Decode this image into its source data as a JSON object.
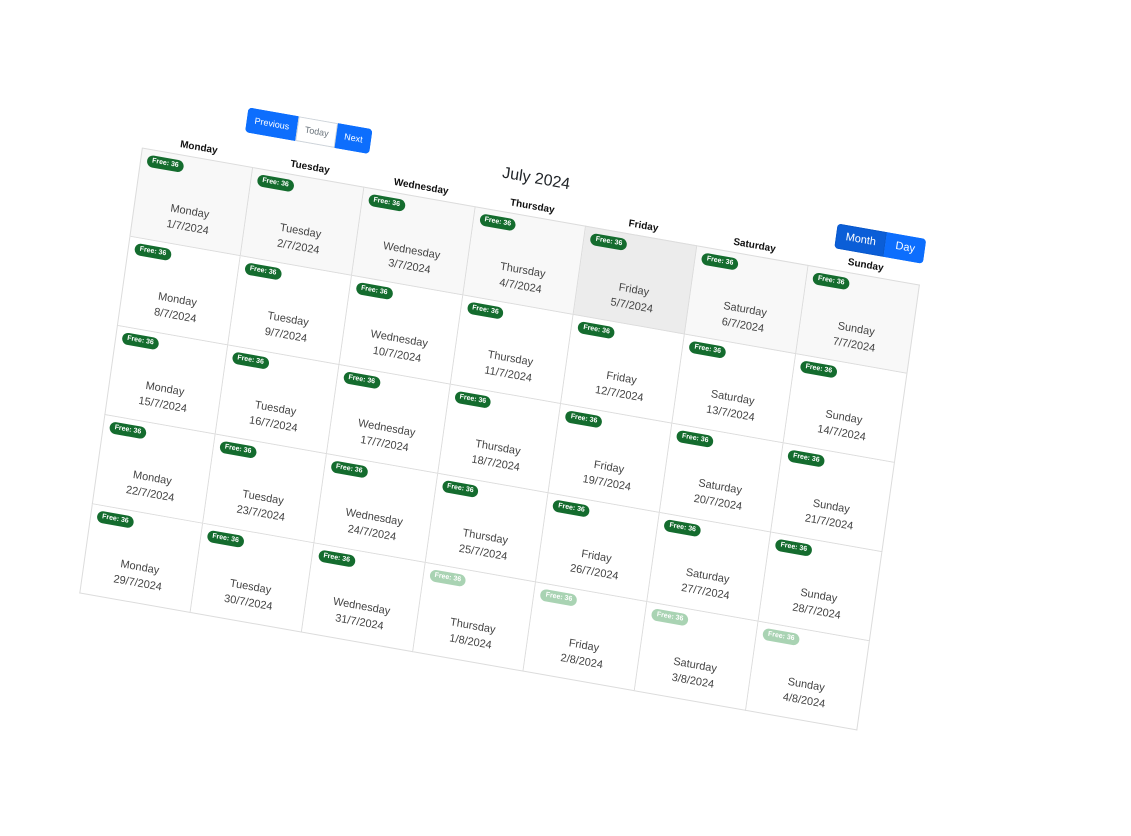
{
  "toolbar": {
    "previous_label": "Previous",
    "today_label": "Today",
    "next_label": "Next",
    "title": "July 2024",
    "month_label": "Month",
    "day_label": "Day"
  },
  "weekdays": [
    "Monday",
    "Tuesday",
    "Wednesday",
    "Thursday",
    "Friday",
    "Saturday",
    "Sunday"
  ],
  "weeks": [
    [
      {
        "badge": "Free: 36",
        "day": "Monday",
        "date": "1/7/2024",
        "state": "shade"
      },
      {
        "badge": "Free: 36",
        "day": "Tuesday",
        "date": "2/7/2024",
        "state": "shade"
      },
      {
        "badge": "Free: 36",
        "day": "Wednesday",
        "date": "3/7/2024",
        "state": "shade"
      },
      {
        "badge": "Free: 36",
        "day": "Thursday",
        "date": "4/7/2024",
        "state": "shade"
      },
      {
        "badge": "Free: 36",
        "day": "Friday",
        "date": "5/7/2024",
        "state": "today"
      },
      {
        "badge": "Free: 36",
        "day": "Saturday",
        "date": "6/7/2024",
        "state": "shade"
      },
      {
        "badge": "Free: 36",
        "day": "Sunday",
        "date": "7/7/2024",
        "state": "shade"
      }
    ],
    [
      {
        "badge": "Free: 36",
        "day": "Monday",
        "date": "8/7/2024",
        "state": "normal"
      },
      {
        "badge": "Free: 36",
        "day": "Tuesday",
        "date": "9/7/2024",
        "state": "normal"
      },
      {
        "badge": "Free: 36",
        "day": "Wednesday",
        "date": "10/7/2024",
        "state": "normal"
      },
      {
        "badge": "Free: 36",
        "day": "Thursday",
        "date": "11/7/2024",
        "state": "normal"
      },
      {
        "badge": "Free: 36",
        "day": "Friday",
        "date": "12/7/2024",
        "state": "normal"
      },
      {
        "badge": "Free: 36",
        "day": "Saturday",
        "date": "13/7/2024",
        "state": "normal"
      },
      {
        "badge": "Free: 36",
        "day": "Sunday",
        "date": "14/7/2024",
        "state": "normal"
      }
    ],
    [
      {
        "badge": "Free: 36",
        "day": "Monday",
        "date": "15/7/2024",
        "state": "normal"
      },
      {
        "badge": "Free: 36",
        "day": "Tuesday",
        "date": "16/7/2024",
        "state": "normal"
      },
      {
        "badge": "Free: 36",
        "day": "Wednesday",
        "date": "17/7/2024",
        "state": "normal"
      },
      {
        "badge": "Free: 36",
        "day": "Thursday",
        "date": "18/7/2024",
        "state": "normal"
      },
      {
        "badge": "Free: 36",
        "day": "Friday",
        "date": "19/7/2024",
        "state": "normal"
      },
      {
        "badge": "Free: 36",
        "day": "Saturday",
        "date": "20/7/2024",
        "state": "normal"
      },
      {
        "badge": "Free: 36",
        "day": "Sunday",
        "date": "21/7/2024",
        "state": "normal"
      }
    ],
    [
      {
        "badge": "Free: 36",
        "day": "Monday",
        "date": "22/7/2024",
        "state": "normal"
      },
      {
        "badge": "Free: 36",
        "day": "Tuesday",
        "date": "23/7/2024",
        "state": "normal"
      },
      {
        "badge": "Free: 36",
        "day": "Wednesday",
        "date": "24/7/2024",
        "state": "normal"
      },
      {
        "badge": "Free: 36",
        "day": "Thursday",
        "date": "25/7/2024",
        "state": "normal"
      },
      {
        "badge": "Free: 36",
        "day": "Friday",
        "date": "26/7/2024",
        "state": "normal"
      },
      {
        "badge": "Free: 36",
        "day": "Saturday",
        "date": "27/7/2024",
        "state": "normal"
      },
      {
        "badge": "Free: 36",
        "day": "Sunday",
        "date": "28/7/2024",
        "state": "normal"
      }
    ],
    [
      {
        "badge": "Free: 36",
        "day": "Monday",
        "date": "29/7/2024",
        "state": "normal"
      },
      {
        "badge": "Free: 36",
        "day": "Tuesday",
        "date": "30/7/2024",
        "state": "normal"
      },
      {
        "badge": "Free: 36",
        "day": "Wednesday",
        "date": "31/7/2024",
        "state": "normal"
      },
      {
        "badge": "Free: 36",
        "day": "Thursday",
        "date": "1/8/2024",
        "state": "faded"
      },
      {
        "badge": "Free: 36",
        "day": "Friday",
        "date": "2/8/2024",
        "state": "faded"
      },
      {
        "badge": "Free: 36",
        "day": "Saturday",
        "date": "3/8/2024",
        "state": "faded"
      },
      {
        "badge": "Free: 36",
        "day": "Sunday",
        "date": "4/8/2024",
        "state": "faded"
      }
    ]
  ],
  "colors": {
    "primary": "#0d6efd",
    "badge_green": "#146c2e",
    "badge_faded": "#a9d3b3",
    "today_bg": "#ececec"
  }
}
